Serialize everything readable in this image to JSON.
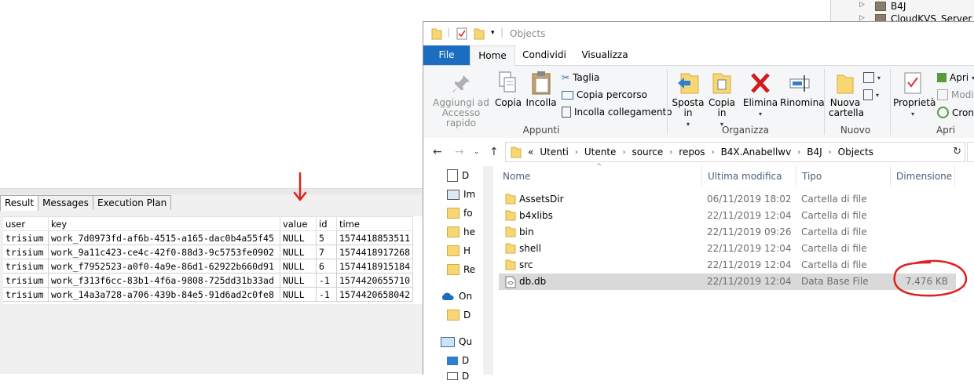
{
  "sql": {
    "tabs": [
      "Result",
      "Messages",
      "Execution Plan"
    ],
    "columns": [
      "user",
      "key",
      "value",
      "id",
      "time"
    ],
    "rows": [
      [
        "trisium",
        "work_7d0973fd-af6b-4515-a165-dac0b4a55f45",
        "NULL",
        "5",
        "1574418853511"
      ],
      [
        "trisium",
        "work_9a11c423-ce4c-42f0-88d3-9c5753fe0902",
        "NULL",
        "7",
        "1574418917268"
      ],
      [
        "trisium",
        "work_f7952523-a0f0-4a9e-86d1-62922b660d91",
        "NULL",
        "6",
        "1574418915184"
      ],
      [
        "trisium",
        "work_f313f6cc-83b1-4f6a-9808-725dd31b33ad",
        "NULL",
        "-1",
        "1574420655710"
      ],
      [
        "trisium",
        "work_14a3a728-a706-439b-84e5-91d6ad2c0fe8",
        "NULL",
        "-1",
        "1574420658042"
      ]
    ],
    "annotation_color": "#e02020"
  },
  "solution_explorer": {
    "items": [
      "B4J",
      "CloudKVS_Server"
    ]
  },
  "explorer": {
    "title": "Objects",
    "ribbon_tabs": [
      "File",
      "Home",
      "Condividi",
      "Visualizza"
    ],
    "clipboard": {
      "pin_label_1": "Aggiungi ad",
      "pin_label_2": "Accesso rapido",
      "copy": "Copia",
      "paste": "Incolla",
      "cut": "Taglia",
      "copy_path": "Copia percorso",
      "paste_shortcut": "Incolla collegamento",
      "group": "Appunti"
    },
    "organize": {
      "move_1": "Sposta",
      "move_2": "in",
      "copyto_1": "Copia",
      "copyto_2": "in",
      "delete": "Elimina",
      "rename": "Rinomina",
      "group": "Organizza"
    },
    "new": {
      "folder_1": "Nuova",
      "folder_2": "cartella",
      "group": "Nuovo"
    },
    "open": {
      "properties": "Proprietà",
      "open": "Apri",
      "edit": "Modifi",
      "history": "Cronol",
      "group": "Apri"
    },
    "breadcrumb": [
      "Utenti",
      "Utente",
      "source",
      "repos",
      "B4X.Anabellwv",
      "B4J",
      "Objects"
    ],
    "breadcrumb_prefix": "«",
    "nav_items": [
      "D",
      "Im",
      "fo",
      "he",
      "H",
      "Re",
      "On",
      "D",
      "Qu",
      "D",
      "D"
    ],
    "columns": {
      "name": "Nome",
      "modified": "Ultima modifica",
      "type": "Tipo",
      "size": "Dimensione"
    },
    "files": [
      {
        "name": "AssetsDir",
        "modified": "06/11/2019 18:02",
        "type": "Cartella di file",
        "size": "",
        "kind": "folder"
      },
      {
        "name": "b4xlibs",
        "modified": "22/11/2019 12:04",
        "type": "Cartella di file",
        "size": "",
        "kind": "folder"
      },
      {
        "name": "bin",
        "modified": "22/11/2019 09:26",
        "type": "Cartella di file",
        "size": "",
        "kind": "folder"
      },
      {
        "name": "shell",
        "modified": "22/11/2019 12:04",
        "type": "Cartella di file",
        "size": "",
        "kind": "folder"
      },
      {
        "name": "src",
        "modified": "22/11/2019 12:04",
        "type": "Cartella di file",
        "size": "",
        "kind": "folder"
      },
      {
        "name": "db.db",
        "modified": "22/11/2019 12:04",
        "type": "Data Base File",
        "size": "7.476 KB",
        "kind": "file"
      }
    ],
    "accent": "#1a6dbf"
  }
}
